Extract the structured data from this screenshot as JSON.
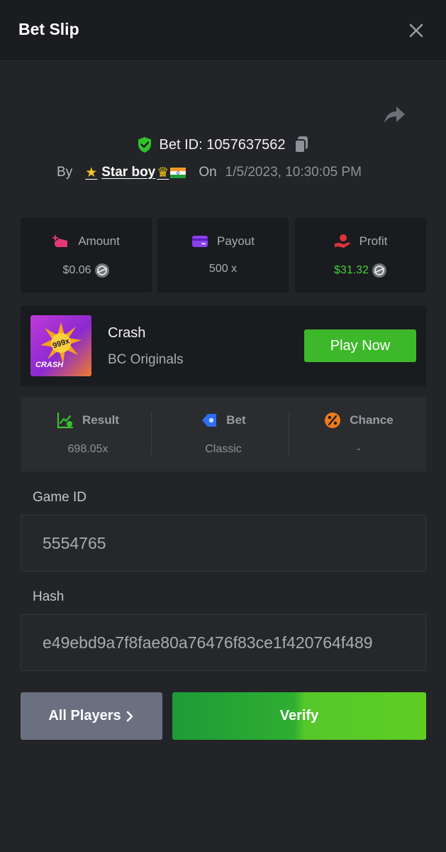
{
  "header": {
    "title": "Bet Slip"
  },
  "bet": {
    "id_label": "Bet ID: 1057637562",
    "by_label": "By",
    "user_name": "Star boy",
    "on_label": "On",
    "date": "1/5/2023, 10:30:05 PM"
  },
  "stats": {
    "amount": {
      "label": "Amount",
      "value": "$0.06"
    },
    "payout": {
      "label": "Payout",
      "value": "500 x"
    },
    "profit": {
      "label": "Profit",
      "value": "$31.32"
    }
  },
  "game": {
    "thumb_badge": "999x",
    "thumb_label": "CRASH",
    "name": "Crash",
    "provider": "BC Originals",
    "play_label": "Play Now"
  },
  "info": {
    "result": {
      "label": "Result",
      "value": "698.05x"
    },
    "bet": {
      "label": "Bet",
      "value": "Classic"
    },
    "chance": {
      "label": "Chance",
      "value": "-"
    }
  },
  "fields": {
    "game_id_label": "Game ID",
    "game_id_value": "5554765",
    "hash_label": "Hash",
    "hash_value": "e49ebd9a7f8fae80a76476f83ce1f420764f489"
  },
  "buttons": {
    "all_players": "All Players",
    "verify": "Verify"
  },
  "colors": {
    "background": "#232427",
    "card": "#1a1b1e",
    "accent_green": "#3db82a",
    "profit_green": "#3fd13a",
    "button_gray": "#6b7081"
  }
}
